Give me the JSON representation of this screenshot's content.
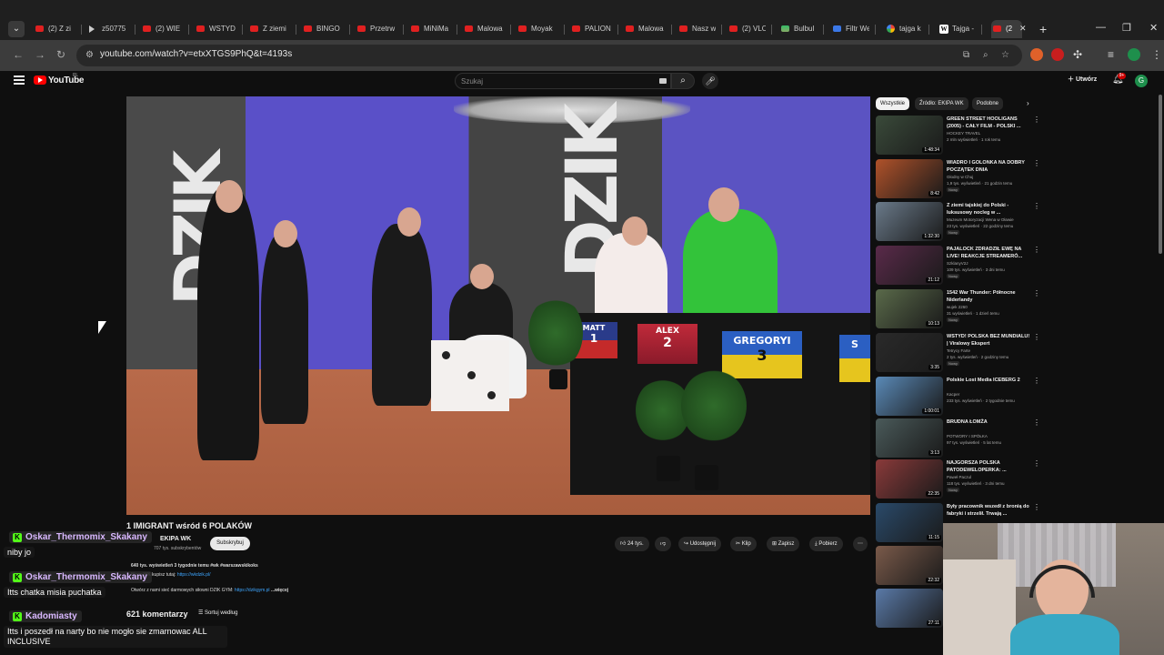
{
  "browser": {
    "tabs": [
      {
        "label": "(2) Z zi",
        "icon": "youtube"
      },
      {
        "label": "z50775",
        "icon": "play"
      },
      {
        "label": "(2) WIE",
        "icon": "youtube"
      },
      {
        "label": "WSTYD",
        "icon": "youtube"
      },
      {
        "label": "Z ziemi",
        "icon": "youtube"
      },
      {
        "label": "BINGO",
        "icon": "youtube"
      },
      {
        "label": "Przetrw",
        "icon": "youtube"
      },
      {
        "label": "MiNiMa",
        "icon": "youtube"
      },
      {
        "label": "Malowa",
        "icon": "youtube"
      },
      {
        "label": "Moyak",
        "icon": "youtube"
      },
      {
        "label": "PALION",
        "icon": "youtube"
      },
      {
        "label": "Malowa",
        "icon": "youtube"
      },
      {
        "label": "Nasz w",
        "icon": "youtube"
      },
      {
        "label": "(2) VLO",
        "icon": "youtube"
      },
      {
        "label": "Bulbul",
        "icon": "image"
      },
      {
        "label": "Filtr We",
        "icon": "blue"
      },
      {
        "label": "tajga k",
        "icon": "google"
      },
      {
        "label": "Tajga -",
        "icon": "wikipedia"
      },
      {
        "label": "(2",
        "icon": "youtube"
      }
    ],
    "url": "youtube.com/watch?v=etxXTGS9PhQ&t=4193s"
  },
  "youtube": {
    "logo_text": "YouTube",
    "country_code": "PL",
    "search_placeholder": "Szukaj",
    "create_label": "Utwórz",
    "notification_count": "9+",
    "avatar_letter": "G"
  },
  "video": {
    "title": "1 IMIGRANT wśród 6 POLAKÓW",
    "channel": "EKIPA WK",
    "subscribers": "707 tys. subskrybentów",
    "subscribe_label": "Subskrybuj",
    "likes": "24 tys.",
    "share_label": "Udostępnij",
    "clip_label": "Klip",
    "save_label": "Zapisz",
    "download_label": "Pobierz",
    "desc_stats": "640 tys. wyświetleń  3 tygodnie temu  #wk #warszawskikoks",
    "desc_line2_prefix": "Bluzy WK kupisz tutaj:",
    "desc_line2_link": "https://wkdzik.pl/",
    "desc_line3_prefix": "Otwórz z nami sieć darmowych siłowni DZIK GYM:",
    "desc_line3_link": "https://dzikgym.pl",
    "desc_more": "...więcej",
    "comment_count": "621 komentarzy",
    "sort_label": "Sortuj według",
    "scene": {
      "sign_text": "DZIK",
      "plates": [
        {
          "name": "MATT",
          "number": "1"
        },
        {
          "name": "ALEX",
          "number": "2"
        },
        {
          "name": "GREGORYI",
          "number": "3"
        },
        {
          "name": "S",
          "number": ""
        }
      ]
    }
  },
  "chat": [
    {
      "user": "Oskar_Thermomix_Skakany",
      "message": "niby jo"
    },
    {
      "user": "Oskar_Thermomix_Skakany",
      "message": "Itts chatka misia puchatka"
    },
    {
      "user": "Kadomiasty",
      "message": "Itts i poszedł na narty bo nie mogło sie zmarnowac ALL INCLUSIVE"
    }
  ],
  "sidebar": {
    "chips": [
      "Wszystkie",
      "Źródło: EKIPA WK",
      "Podobne"
    ],
    "recommendations": [
      {
        "title": "GREEN STREET HOOLIGANS (2005) - CAŁY FILM - POLSKI ...",
        "channel": "HOCKEY TRAVEL",
        "meta": "2 mln wyświetleń · 1 rok temu",
        "duration": "1:48:34",
        "badge": "",
        "thumb": "#3a4a3a"
      },
      {
        "title": "WIADRO I GOLONKA NA DOBRY POCZĄTEK DNIA",
        "channel": "Głodny w Chuj",
        "meta": "1,9 tys. wyświetleń · 21 godzin temu",
        "duration": "8:42",
        "badge": "Nowy",
        "thumb": "#b0522a"
      },
      {
        "title": "Z ziemi tajskiej do Polski - luksusowy nocleg w ...",
        "channel": "Muzeum Motoryzacji Wena w Oławie",
        "meta": "23 tys. wyświetleń · 22 godziny temu",
        "duration": "1:32:30",
        "badge": "Nowy",
        "thumb": "#6a7a8a"
      },
      {
        "title": "PAJALOCK ZDRADZIŁ EWĘ NA LIVE! REAKCJE STREAMERÓ...",
        "channel": "SzklanyV2J",
        "meta": "109 tys. wyświetleń · 3 dni temu",
        "duration": "21:12",
        "badge": "Nowy",
        "thumb": "#5a2a4a"
      },
      {
        "title": "1542 War Thunder: Północne Niderlandy",
        "channel": "wujek 2260",
        "meta": "31 wyświetleń · 1 dzień temu",
        "duration": "10:13",
        "badge": "Nowy",
        "thumb": "#5a6a4a"
      },
      {
        "title": "WSTYD! POLSKA BEZ MUNDIALU! | Viralowy Ekspert",
        "channel": "Tetrycy Farte",
        "meta": "2 tys. wyświetleń · 2 godziny temu",
        "duration": "3:35",
        "badge": "Nowy",
        "thumb": "#2a2a2a"
      },
      {
        "title": "Polskie Lost Media ICEBERG 2",
        "channel": "Kacper",
        "meta": "233 tys. wyświetleń · 2 tygodnie temu",
        "duration": "1:00:01",
        "badge": "",
        "thumb": "#5a8ab8"
      },
      {
        "title": "BRUDNA ŁOMŻA",
        "channel": "POTWORY I SPÓŁKA",
        "meta": "97 tys. wyświetleń · 5 lat temu",
        "duration": "3:13",
        "badge": "",
        "thumb": "#4a5a5a"
      },
      {
        "title": "NAJGORSZA POLSKA PATODEWELOPERKA: ...",
        "channel": "Paweł Paczul",
        "meta": "118 tys. wyświetleń · 3 dni temu",
        "duration": "22:35",
        "badge": "Nowy",
        "thumb": "#8a3a3a"
      },
      {
        "title": "Były pracownik wszedł z bronią do fabryki i strzelił. Trwają ...",
        "channel": "",
        "meta": "",
        "duration": "11:15",
        "badge": "",
        "thumb": "#2a4a6a"
      },
      {
        "title": "",
        "channel": "",
        "meta": "",
        "duration": "22:32",
        "badge": "",
        "thumb": "#7a5a4a"
      },
      {
        "title": "",
        "channel": "",
        "meta": "",
        "duration": "27:11",
        "badge": "",
        "thumb": "#5a7aa8"
      }
    ]
  }
}
